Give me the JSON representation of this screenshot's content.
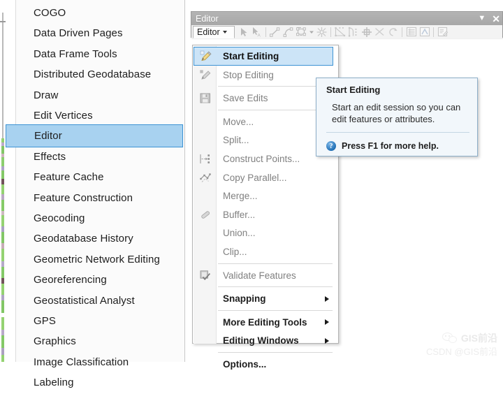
{
  "command_list": {
    "items": [
      {
        "label": "COGO",
        "selected": false
      },
      {
        "label": "Data Driven Pages",
        "selected": false
      },
      {
        "label": "Data Frame Tools",
        "selected": false
      },
      {
        "label": "Distributed Geodatabase",
        "selected": false
      },
      {
        "label": "Draw",
        "selected": false
      },
      {
        "label": "Edit Vertices",
        "selected": false
      },
      {
        "label": "Editor",
        "selected": true
      },
      {
        "label": "Effects",
        "selected": false
      },
      {
        "label": "Feature Cache",
        "selected": false
      },
      {
        "label": "Feature Construction",
        "selected": false
      },
      {
        "label": "Geocoding",
        "selected": false
      },
      {
        "label": "Geodatabase History",
        "selected": false
      },
      {
        "label": "Geometric Network Editing",
        "selected": false
      },
      {
        "label": "Georeferencing",
        "selected": false
      },
      {
        "label": "Geostatistical Analyst",
        "selected": false
      },
      {
        "label": "GPS",
        "selected": false
      },
      {
        "label": "Graphics",
        "selected": false
      },
      {
        "label": "Image Classification",
        "selected": false
      },
      {
        "label": "Labeling",
        "selected": false
      }
    ]
  },
  "editor_window": {
    "title": "Editor",
    "titlebar_buttons": [
      {
        "name": "dropdown-arrow-button",
        "glyph": "▼"
      },
      {
        "name": "close-button",
        "glyph": "✕"
      }
    ],
    "dropdown_button_label": "Editor",
    "toolbar_icons": [
      "edit-tool-arrow-icon",
      "edit-annotation-arrow-icon",
      "separator",
      "straight-segment-icon",
      "curved-segment-icon",
      "trace-icon",
      "trace-dropdown-caret",
      "split-tool-icon",
      "separator",
      "reshape-feature-icon",
      "topology-edit-icon",
      "mirror-features-icon",
      "cut-polygons-icon",
      "rotate-icon",
      "separator",
      "attributes-table-icon",
      "sketch-properties-icon",
      "separator",
      "create-features-icon"
    ]
  },
  "editor_menu": {
    "items": [
      {
        "label": "Start Editing",
        "state": "highlight",
        "icon": "pencil-start-editing-icon",
        "submenu": false
      },
      {
        "label": "Stop Editing",
        "state": "disabled",
        "icon": "pencil-stop-editing-icon",
        "submenu": false
      },
      {
        "label": "Save Edits",
        "state": "disabled",
        "icon": "save-edits-icon",
        "submenu": false,
        "separator_above": true
      },
      {
        "label": "Move...",
        "state": "disabled",
        "icon": "",
        "submenu": false,
        "separator_above": true
      },
      {
        "label": "Split...",
        "state": "disabled",
        "icon": "",
        "submenu": false
      },
      {
        "label": "Construct Points...",
        "state": "disabled",
        "icon": "construct-points-icon",
        "submenu": false
      },
      {
        "label": "Copy Parallel...",
        "state": "disabled",
        "icon": "copy-parallel-icon",
        "submenu": false
      },
      {
        "label": "Merge...",
        "state": "disabled",
        "icon": "",
        "submenu": false
      },
      {
        "label": "Buffer...",
        "state": "disabled",
        "icon": "buffer-icon",
        "submenu": false
      },
      {
        "label": "Union...",
        "state": "disabled",
        "icon": "",
        "submenu": false
      },
      {
        "label": "Clip...",
        "state": "disabled",
        "icon": "",
        "submenu": false
      },
      {
        "label": "Validate Features",
        "state": "disabled",
        "icon": "validate-features-icon",
        "submenu": false,
        "separator_above": true
      },
      {
        "label": "Snapping",
        "state": "enabled",
        "icon": "",
        "submenu": true,
        "separator_above": true
      },
      {
        "label": "More Editing Tools",
        "state": "enabled",
        "icon": "",
        "submenu": true,
        "separator_above": true
      },
      {
        "label": "Editing Windows",
        "state": "enabled",
        "icon": "",
        "submenu": true
      },
      {
        "label": "Options...",
        "state": "enabled",
        "icon": "",
        "submenu": false,
        "separator_above": true
      }
    ]
  },
  "tooltip": {
    "title": "Start Editing",
    "body": "Start an edit session so you can edit features or attributes.",
    "footer": "Press F1 for more help.",
    "help_glyph": "?"
  },
  "watermark": {
    "line1": "GIS前沿",
    "line2": "CSDN @GIS前沿"
  },
  "colors": {
    "selection_fill": "#a8d2f0",
    "selection_border": "#3d93d4",
    "menu_highlight_fill": "#cce4f7",
    "tooltip_bg": "#f2f7fb",
    "tooltip_border": "#8dafc9",
    "titlebar": "#aeaeae"
  }
}
